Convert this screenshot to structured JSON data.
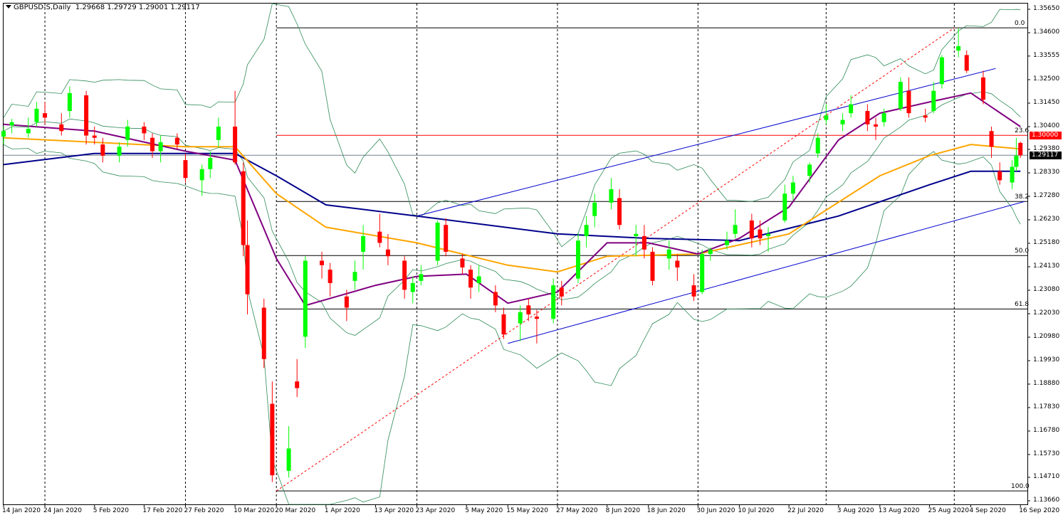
{
  "header": {
    "symbol": "GBPUSD-S,Daily",
    "ohlc": "1.29668 1.29729 1.29001 1.29117"
  },
  "price_axis": {
    "ticks": [
      "1.35650",
      "1.34600",
      "1.33555",
      "1.32500",
      "1.31450",
      "1.30400",
      "1.29380",
      "1.28330",
      "1.27280",
      "1.26230",
      "1.25180",
      "1.24130",
      "1.23080",
      "1.22030",
      "1.20980",
      "1.19930",
      "1.18880",
      "1.17830",
      "1.16780",
      "1.15730",
      "1.14710",
      "1.13660"
    ],
    "current_price": "1.29117",
    "level_price": "1.30000"
  },
  "date_axis": [
    "14 Jan 2020",
    "24 Jan 2020",
    "5 Feb 2020",
    "17 Feb 2020",
    "27 Feb 2020",
    "10 Mar 2020",
    "20 Mar 2020",
    "1 Apr 2020",
    "13 Apr 2020",
    "23 Apr 2020",
    "5 May 2020",
    "15 May 2020",
    "27 May 2020",
    "8 Jun 2020",
    "18 Jun 2020",
    "30 Jun 2020",
    "10 Jul 2020",
    "22 Jul 2020",
    "3 Aug 2020",
    "13 Aug 2020",
    "25 Aug 2020",
    "4 Sep 2020",
    "16 Sep 2020"
  ],
  "fib_levels": [
    {
      "label": "0.0",
      "price": 1.3482
    },
    {
      "label": "23.6",
      "price": 1.3001
    },
    {
      "label": "38.2",
      "price": 1.2705
    },
    {
      "label": "50.0",
      "price": 1.2463
    },
    {
      "label": "61.8",
      "price": 1.2224
    },
    {
      "label": "100.0",
      "price": 1.141
    }
  ],
  "colors": {
    "bull": "#00ff00",
    "bear": "#ff0000",
    "ma_fast": "#800080",
    "ma_mid": "#ffa500",
    "ma_slow": "#00008b",
    "bands": "#2e8b57",
    "trend": "#0000cd",
    "fib_line": "#000000",
    "level": "#ff0000"
  },
  "chart_data": {
    "type": "candlestick",
    "title": "GBPUSD-S,Daily",
    "ylim": [
      1.1366,
      1.361
    ],
    "x_range": [
      "2020-01-14",
      "2020-09-17"
    ],
    "grid": "vertical dashed lines at date ticks",
    "candles": [
      [
        "2020-01-14",
        1.2995,
        1.304,
        1.296,
        1.302
      ],
      [
        "2020-01-16",
        1.3045,
        1.3075,
        1.301,
        1.306
      ],
      [
        "2020-01-20",
        1.301,
        1.308,
        1.299,
        1.303
      ],
      [
        "2020-01-22",
        1.306,
        1.315,
        1.304,
        1.312
      ],
      [
        "2020-01-24",
        1.31,
        1.315,
        1.305,
        1.308
      ],
      [
        "2020-01-28",
        1.305,
        1.31,
        1.3,
        1.302
      ],
      [
        "2020-01-30",
        1.311,
        1.322,
        1.308,
        1.319
      ],
      [
        "2020-02-03",
        1.318,
        1.32,
        1.296,
        1.3
      ],
      [
        "2020-02-05",
        1.3,
        1.304,
        1.296,
        1.299
      ],
      [
        "2020-02-07",
        1.296,
        1.299,
        1.288,
        1.291
      ],
      [
        "2020-02-11",
        1.291,
        1.297,
        1.288,
        1.295
      ],
      [
        "2020-02-13",
        1.298,
        1.307,
        1.295,
        1.304
      ],
      [
        "2020-02-17",
        1.304,
        1.306,
        1.298,
        1.301
      ],
      [
        "2020-02-19",
        1.299,
        1.301,
        1.29,
        1.293
      ],
      [
        "2020-02-21",
        1.293,
        1.3,
        1.288,
        1.297
      ],
      [
        "2020-02-25",
        1.299,
        1.301,
        1.294,
        1.296
      ],
      [
        "2020-02-27",
        1.289,
        1.292,
        1.279,
        1.281
      ],
      [
        "2020-03-02",
        1.28,
        1.287,
        1.273,
        1.285
      ],
      [
        "2020-03-04",
        1.285,
        1.293,
        1.281,
        1.29
      ],
      [
        "2020-03-06",
        1.298,
        1.308,
        1.295,
        1.304
      ],
      [
        "2020-03-10",
        1.304,
        1.32,
        1.287,
        1.288
      ],
      [
        "2020-03-12",
        1.284,
        1.288,
        1.246,
        1.251
      ],
      [
        "2020-03-13",
        1.251,
        1.262,
        1.22,
        1.229
      ],
      [
        "2020-03-17",
        1.223,
        1.227,
        1.196,
        1.2
      ],
      [
        "2020-03-19",
        1.18,
        1.19,
        1.145,
        1.148
      ],
      [
        "2020-03-23",
        1.15,
        1.17,
        1.147,
        1.16
      ],
      [
        "2020-03-25",
        1.19,
        1.2,
        1.183,
        1.187
      ],
      [
        "2020-03-27",
        1.21,
        1.246,
        1.205,
        1.244
      ],
      [
        "2020-03-31",
        1.244,
        1.248,
        1.236,
        1.242
      ],
      [
        "2020-04-02",
        1.24,
        1.243,
        1.228,
        1.234
      ],
      [
        "2020-04-06",
        1.228,
        1.231,
        1.217,
        1.223
      ],
      [
        "2020-04-08",
        1.235,
        1.244,
        1.231,
        1.239
      ],
      [
        "2020-04-10",
        1.248,
        1.26,
        1.24,
        1.255
      ],
      [
        "2020-04-14",
        1.257,
        1.265,
        1.25,
        1.252
      ],
      [
        "2020-04-16",
        1.249,
        1.256,
        1.242,
        1.246
      ],
      [
        "2020-04-20",
        1.244,
        1.246,
        1.227,
        1.231
      ],
      [
        "2020-04-22",
        1.23,
        1.237,
        1.225,
        1.234
      ],
      [
        "2020-04-24",
        1.235,
        1.242,
        1.233,
        1.238
      ],
      [
        "2020-04-28",
        1.244,
        1.262,
        1.242,
        1.261
      ],
      [
        "2020-04-30",
        1.26,
        1.263,
        1.246,
        1.248
      ],
      [
        "2020-05-04",
        1.245,
        1.247,
        1.238,
        1.241
      ],
      [
        "2020-05-06",
        1.24,
        1.242,
        1.227,
        1.232
      ],
      [
        "2020-05-08",
        1.234,
        1.242,
        1.23,
        1.237
      ],
      [
        "2020-05-12",
        1.23,
        1.233,
        1.221,
        1.224
      ],
      [
        "2020-05-14",
        1.22,
        1.223,
        1.209,
        1.211
      ],
      [
        "2020-05-18",
        1.216,
        1.224,
        1.208,
        1.221
      ],
      [
        "2020-05-20",
        1.224,
        1.227,
        1.217,
        1.22
      ],
      [
        "2020-05-22",
        1.219,
        1.222,
        1.207,
        1.218
      ],
      [
        "2020-05-26",
        1.218,
        1.236,
        1.216,
        1.233
      ],
      [
        "2020-05-28",
        1.232,
        1.235,
        1.224,
        1.228
      ],
      [
        "2020-06-01",
        1.236,
        1.256,
        1.234,
        1.253
      ],
      [
        "2020-06-03",
        1.255,
        1.264,
        1.25,
        1.26
      ],
      [
        "2020-06-05",
        1.264,
        1.274,
        1.259,
        1.27
      ],
      [
        "2020-06-09",
        1.27,
        1.281,
        1.267,
        1.276
      ],
      [
        "2020-06-11",
        1.272,
        1.276,
        1.258,
        1.26
      ],
      [
        "2020-06-15",
        1.255,
        1.26,
        1.246,
        1.256
      ],
      [
        "2020-06-17",
        1.255,
        1.26,
        1.245,
        1.249
      ],
      [
        "2020-06-19",
        1.248,
        1.25,
        1.233,
        1.235
      ],
      [
        "2020-06-23",
        1.245,
        1.253,
        1.24,
        1.249
      ],
      [
        "2020-06-25",
        1.244,
        1.247,
        1.235,
        1.241
      ],
      [
        "2020-06-29",
        1.233,
        1.238,
        1.226,
        1.228
      ],
      [
        "2020-07-01",
        1.23,
        1.249,
        1.229,
        1.247
      ],
      [
        "2020-07-03",
        1.247,
        1.25,
        1.244,
        1.249
      ],
      [
        "2020-07-07",
        1.251,
        1.257,
        1.249,
        1.253
      ],
      [
        "2020-07-09",
        1.256,
        1.267,
        1.254,
        1.26
      ],
      [
        "2020-07-13",
        1.262,
        1.265,
        1.25,
        1.254
      ],
      [
        "2020-07-15",
        1.258,
        1.262,
        1.251,
        1.254
      ],
      [
        "2020-07-17",
        1.255,
        1.259,
        1.248,
        1.256
      ],
      [
        "2020-07-21",
        1.262,
        1.278,
        1.261,
        1.274
      ],
      [
        "2020-07-23",
        1.274,
        1.282,
        1.271,
        1.279
      ],
      [
        "2020-07-27",
        1.282,
        1.288,
        1.279,
        1.287
      ],
      [
        "2020-07-29",
        1.292,
        1.301,
        1.29,
        1.299
      ],
      [
        "2020-07-31",
        1.307,
        1.314,
        1.305,
        1.309
      ],
      [
        "2020-08-04",
        1.305,
        1.31,
        1.302,
        1.307
      ],
      [
        "2020-08-06",
        1.31,
        1.318,
        1.308,
        1.314
      ],
      [
        "2020-08-10",
        1.311,
        1.314,
        1.302,
        1.305
      ],
      [
        "2020-08-12",
        1.305,
        1.308,
        1.298,
        1.304
      ],
      [
        "2020-08-14",
        1.306,
        1.312,
        1.304,
        1.31
      ],
      [
        "2020-08-18",
        1.312,
        1.326,
        1.311,
        1.324
      ],
      [
        "2020-08-20",
        1.32,
        1.326,
        1.308,
        1.31
      ],
      [
        "2020-08-24",
        1.309,
        1.312,
        1.306,
        1.308
      ],
      [
        "2020-08-26",
        1.311,
        1.324,
        1.31,
        1.32
      ],
      [
        "2020-08-28",
        1.323,
        1.336,
        1.321,
        1.335
      ],
      [
        "2020-09-01",
        1.338,
        1.348,
        1.335,
        1.34
      ],
      [
        "2020-09-03",
        1.336,
        1.338,
        1.328,
        1.329
      ],
      [
        "2020-09-07",
        1.326,
        1.329,
        1.314,
        1.316
      ],
      [
        "2020-09-09",
        1.302,
        1.304,
        1.29,
        1.295
      ],
      [
        "2020-09-11",
        1.284,
        1.288,
        1.278,
        1.28
      ],
      [
        "2020-09-14",
        1.279,
        1.289,
        1.276,
        1.286
      ],
      [
        "2020-09-15",
        1.286,
        1.299,
        1.284,
        1.291
      ],
      [
        "2020-09-16",
        1.2967,
        1.2973,
        1.29,
        1.2912
      ]
    ],
    "ma_fast": [
      [
        "2020-01-14",
        1.305
      ],
      [
        "2020-02-05",
        1.302
      ],
      [
        "2020-02-27",
        1.293
      ],
      [
        "2020-03-10",
        1.289
      ],
      [
        "2020-03-20",
        1.245
      ],
      [
        "2020-03-27",
        1.224
      ],
      [
        "2020-04-13",
        1.233
      ],
      [
        "2020-04-23",
        1.237
      ],
      [
        "2020-05-05",
        1.238
      ],
      [
        "2020-05-15",
        1.225
      ],
      [
        "2020-05-27",
        1.23
      ],
      [
        "2020-06-08",
        1.252
      ],
      [
        "2020-06-18",
        1.252
      ],
      [
        "2020-06-30",
        1.247
      ],
      [
        "2020-07-10",
        1.254
      ],
      [
        "2020-07-22",
        1.268
      ],
      [
        "2020-08-03",
        1.298
      ],
      [
        "2020-08-13",
        1.31
      ],
      [
        "2020-08-25",
        1.315
      ],
      [
        "2020-09-04",
        1.319
      ],
      [
        "2020-09-16",
        1.304
      ]
    ],
    "ma_mid": [
      [
        "2020-01-14",
        1.299
      ],
      [
        "2020-02-27",
        1.295
      ],
      [
        "2020-03-10",
        1.295
      ],
      [
        "2020-03-20",
        1.274
      ],
      [
        "2020-04-01",
        1.259
      ],
      [
        "2020-04-23",
        1.252
      ],
      [
        "2020-05-15",
        1.242
      ],
      [
        "2020-05-27",
        1.239
      ],
      [
        "2020-06-08",
        1.246
      ],
      [
        "2020-06-30",
        1.247
      ],
      [
        "2020-07-22",
        1.256
      ],
      [
        "2020-08-13",
        1.282
      ],
      [
        "2020-08-25",
        1.291
      ],
      [
        "2020-09-04",
        1.296
      ],
      [
        "2020-09-16",
        1.294
      ]
    ],
    "ma_slow": [
      [
        "2020-01-14",
        1.287
      ],
      [
        "2020-02-05",
        1.292
      ],
      [
        "2020-03-10",
        1.292
      ],
      [
        "2020-03-20",
        1.282
      ],
      [
        "2020-04-01",
        1.269
      ],
      [
        "2020-04-23",
        1.264
      ],
      [
        "2020-05-27",
        1.256
      ],
      [
        "2020-06-18",
        1.254
      ],
      [
        "2020-07-10",
        1.253
      ],
      [
        "2020-08-03",
        1.264
      ],
      [
        "2020-08-25",
        1.278
      ],
      [
        "2020-09-04",
        1.284
      ],
      [
        "2020-09-16",
        1.284
      ]
    ]
  },
  "annotation_lines": [
    {
      "from": [
        "2020-01-14",
        1.3001
      ],
      "to": [
        "2020-09-17",
        1.3001
      ],
      "role": "level"
    },
    {
      "from": [
        "2020-01-14",
        1.2912
      ],
      "to": [
        "2020-09-17",
        1.2912
      ],
      "role": "current"
    },
    {
      "from": [
        "2020-03-20",
        1.141
      ],
      "to": [
        "2020-08-31",
        1.3482
      ],
      "role": "fib-base"
    },
    {
      "from": [
        "2020-04-23",
        1.264
      ],
      "to": [
        "2020-09-10",
        1.33
      ],
      "role": "channel-top"
    },
    {
      "from": [
        "2020-05-15",
        1.207
      ],
      "to": [
        "2020-09-17",
        1.2705
      ],
      "role": "channel-bottom"
    }
  ]
}
